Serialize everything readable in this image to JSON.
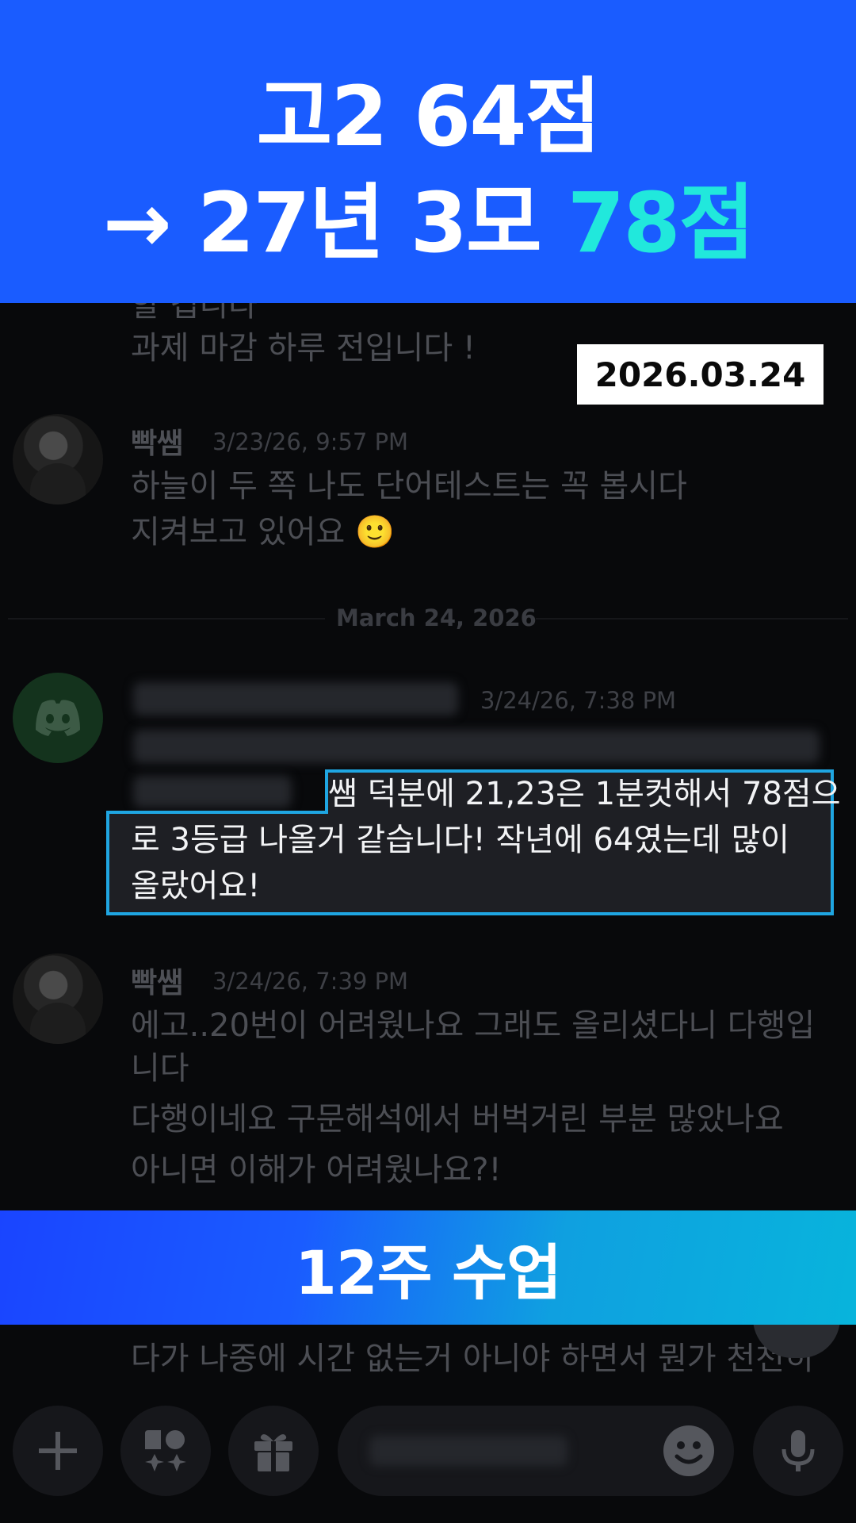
{
  "top_banner": {
    "line1": "고2 64점",
    "line2_prefix": "→ 27년 3모 ",
    "line2_accent": "78점"
  },
  "date_badge": "2026.03.24",
  "messages": {
    "prev_partial": "할 겁니다",
    "prev_line": "과제 마감 하루 전입니다 !",
    "msg1": {
      "author": "빡쌤",
      "timestamp": "3/23/26, 9:57 PM",
      "line1": "하늘이 두 쪽 나도 단어테스트는 꼭 봅시다",
      "line2": "지켜보고 있어요 🙂"
    },
    "date_divider": "March 24, 2026",
    "msg2": {
      "timestamp": "3/24/26, 7:38 PM",
      "highlight_line1": "쌤 덕분에 21,23은 1분컷해서 78점으",
      "highlight_line2": "로 3등급 나올거 같습니다! 작년에 64였는데 많이",
      "highlight_line3": "올랐어요!"
    },
    "msg3": {
      "author": "빡쌤",
      "timestamp": "3/24/26, 7:39 PM",
      "line1": "에고..20번이 어려웠나요 그래도 올리셨다니 다행입",
      "line2": "니다",
      "line3": "다행이네요 구문해석에서 버벅거린 부분 많았나요",
      "line4": "아니면 이해가 어려웠나요?!"
    },
    "bottom_partial": "다가 나중에 시간 없는거 아니야 하면서 뭔가 천천히"
  },
  "bottom_banner": "12주 수업",
  "toolbar": {
    "icons": [
      "plus-icon",
      "apps-icon",
      "gift-icon",
      "emoji-icon",
      "microphone-icon"
    ]
  },
  "colors": {
    "banner_blue": "#1a5cff",
    "accent_cyan": "#21e8dc",
    "highlight_border": "#1fa6e2"
  }
}
